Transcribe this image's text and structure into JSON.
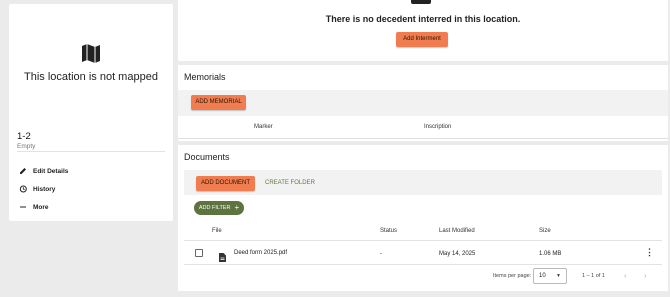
{
  "location": {
    "map_message": "This location is not mapped",
    "name": "1-2",
    "status": "Empty",
    "actions": [
      {
        "label": "Edit Details",
        "icon": "pencil-icon"
      },
      {
        "label": "History",
        "icon": "history-icon"
      },
      {
        "label": "More",
        "icon": "dash-icon"
      }
    ]
  },
  "interment": {
    "message": "There is no decedent interred in this location.",
    "add_button": "Add Interment"
  },
  "memorials": {
    "title": "Memorials",
    "add_button": "ADD MEMORIAL",
    "columns": [
      "Marker",
      "Inscription"
    ]
  },
  "documents": {
    "title": "Documents",
    "add_button": "ADD DOCUMENT",
    "create_folder": "CREATE FOLDER",
    "add_filter": "ADD FILTER",
    "columns": [
      "File",
      "Status",
      "Last Modified",
      "Size"
    ],
    "rows": [
      {
        "file": "Deed form 2025.pdf",
        "status": "-",
        "modified": "May 14, 2025",
        "size": "1.06 MB"
      }
    ],
    "pagination": {
      "label": "Items per page:",
      "per_page": "10",
      "range": "1 – 1 of 1"
    }
  },
  "colors": {
    "accent_orange": "#f07c4f",
    "accent_green": "#5d7340"
  }
}
